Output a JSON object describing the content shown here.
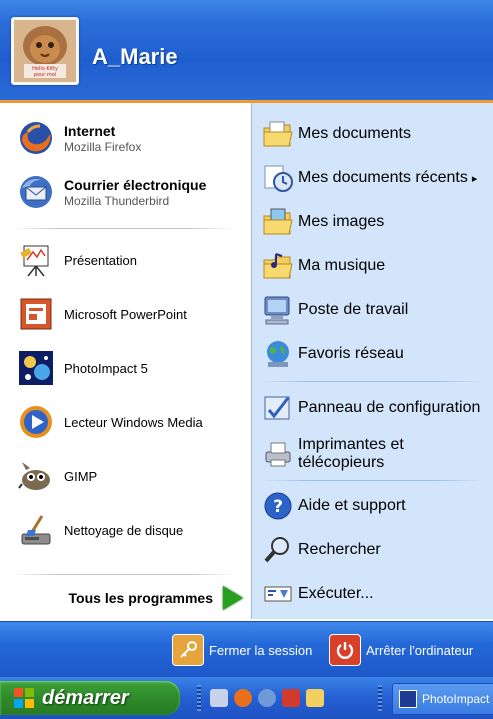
{
  "user": {
    "name": "A_Marie",
    "avatar_caption": "Hello Kitty pour moi"
  },
  "pinned": [
    {
      "title": "Internet",
      "subtitle": "Mozilla Firefox",
      "icon": "firefox-icon"
    },
    {
      "title": "Courrier électronique",
      "subtitle": "Mozilla Thunderbird",
      "icon": "thunderbird-icon"
    }
  ],
  "recent_programs": [
    {
      "label": "Présentation",
      "icon": "presentation-icon"
    },
    {
      "label": "Microsoft PowerPoint",
      "icon": "powerpoint-icon"
    },
    {
      "label": "PhotoImpact 5",
      "icon": "photoimpact-icon"
    },
    {
      "label": "Lecteur Windows Media",
      "icon": "media-player-icon"
    },
    {
      "label": "GIMP",
      "icon": "gimp-icon"
    },
    {
      "label": "Nettoyage de disque",
      "icon": "disk-cleanup-icon"
    }
  ],
  "all_programs": "Tous les programmes",
  "places": [
    {
      "label": "Mes documents",
      "icon": "my-documents-icon",
      "bold": true
    },
    {
      "label": "Mes documents récents",
      "icon": "recent-documents-icon",
      "bold": true,
      "arrow": "▸"
    },
    {
      "label": "Mes images",
      "icon": "my-pictures-icon",
      "bold": true
    },
    {
      "label": "Ma musique",
      "icon": "my-music-icon",
      "bold": true
    },
    {
      "label": "Poste de travail",
      "icon": "my-computer-icon",
      "bold": true
    },
    {
      "label": "Favoris réseau",
      "icon": "network-places-icon",
      "bold": true
    },
    {
      "label": "Panneau de configuration",
      "icon": "control-panel-icon",
      "bold": false
    },
    {
      "label": "Imprimantes et télécopieurs",
      "icon": "printers-icon",
      "bold": false
    },
    {
      "label": "Aide et support",
      "icon": "help-icon",
      "bold": false
    },
    {
      "label": "Rechercher",
      "icon": "search-icon",
      "bold": false
    },
    {
      "label": "Exécuter...",
      "icon": "run-icon",
      "bold": false
    }
  ],
  "footer": {
    "logoff": "Fermer la session",
    "shutdown": "Arrêter l'ordinateur"
  },
  "taskbar": {
    "start": "démarrer",
    "task": "PhotoImpact"
  },
  "colors": {
    "header": "#2d6fda",
    "accent_line": "#ef9a2f",
    "right_pane": "#d3e5fa",
    "start_green": "#2e8a2a"
  }
}
